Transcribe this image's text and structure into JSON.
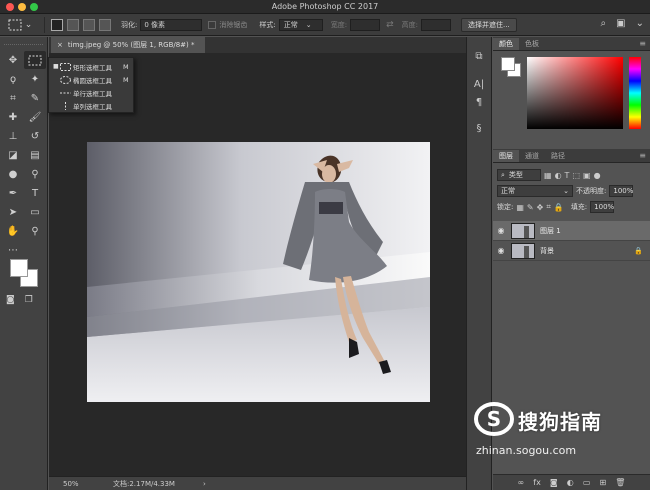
{
  "app": {
    "window_title": "Adobe Photoshop CC 2017"
  },
  "options_bar": {
    "feather_label": "羽化:",
    "feather_value": "0 像素",
    "antialias_label": "消除锯齿",
    "style_label": "样式:",
    "style_value": "正常",
    "width_label": "宽度:",
    "height_label": "高度:",
    "select_mask_button": "选择并遮住..."
  },
  "document": {
    "tab_title": "timg.jpeg @ 50% (图层 1, RGB/8#) *",
    "close_glyph": "×"
  },
  "status_bar": {
    "zoom": "50%",
    "doc_size": "文档:2.17M/4.33M"
  },
  "flyout": {
    "items": [
      {
        "label": "矩形选框工具",
        "key": "M",
        "active": true
      },
      {
        "label": "椭圆选框工具",
        "key": "M",
        "active": false
      },
      {
        "label": "单行选框工具",
        "key": "",
        "active": false
      },
      {
        "label": "单列选框工具",
        "key": "",
        "active": false
      }
    ]
  },
  "color_panel": {
    "tabs": [
      "颜色",
      "色板"
    ]
  },
  "layers_panel": {
    "tabs": [
      "图层",
      "通道",
      "路径"
    ],
    "filter_kind": "类型",
    "blend_mode": "正常",
    "opacity_label": "不透明度:",
    "opacity_value": "100%",
    "lock_label": "锁定:",
    "fill_label": "填充:",
    "fill_value": "100%",
    "layers": [
      {
        "name": "图层 1",
        "selected": true,
        "locked": false
      },
      {
        "name": "背景",
        "selected": false,
        "locked": true
      }
    ],
    "footer_fx": "fx"
  },
  "watermark": {
    "brand": "搜狗指南",
    "url": "zhinan.sogou.com"
  },
  "colors": {
    "titlebar": "#2b2b2b",
    "panel_bg": "#535353",
    "canvas_bg": "#282828",
    "selected_layer": "#6a6a6a"
  }
}
